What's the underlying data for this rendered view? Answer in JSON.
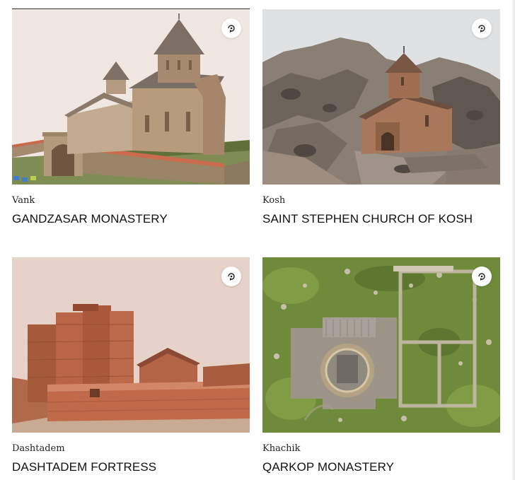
{
  "cards": [
    {
      "location": "Vank",
      "title": "GANDZASAR MONASTERY",
      "image_desc": "Stone church with conical dome and red-roofed perimeter wall",
      "icon": "360-view-icon",
      "background": "#f1e7e2"
    },
    {
      "location": "Kosh",
      "title": "SAINT STEPHEN CHURCH OF KOSH",
      "image_desc": "Stone church on a rocky hillside",
      "icon": "360-view-icon",
      "background": "#dfe1e3"
    },
    {
      "location": "Dashtadem",
      "title": "DASHTADEM FORTRESS",
      "image_desc": "Red stone fortress walls and towers",
      "icon": "360-view-icon",
      "background": "#e6d2c8"
    },
    {
      "location": "Khachik",
      "title": "QARKOP MONASTERY",
      "image_desc": "Aerial view of ruined monastery foundations in grass",
      "icon": "360-view-icon",
      "background": "#6e8a3a"
    }
  ]
}
